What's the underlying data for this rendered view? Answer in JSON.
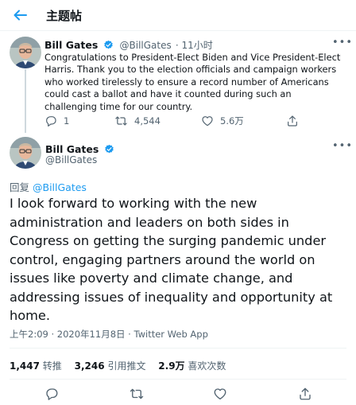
{
  "header": {
    "title": "主题帖"
  },
  "parent_tweet": {
    "author_name": "Bill Gates",
    "author_handle": "@BillGates",
    "time": "· 11小时",
    "text": "Congratulations to President-Elect Biden and Vice President-Elect Harris. Thank you to the election officials and campaign workers who worked tirelessly to ensure a record number of Americans could cast a ballot and have it counted during such an challenging time for our country.",
    "reply_count": "1",
    "retweet_count": "4,544",
    "like_count": "5.6万"
  },
  "main_tweet": {
    "author_name": "Bill Gates",
    "author_handle": "@BillGates",
    "reply_label": "回复",
    "reply_to": "@BillGates",
    "text": "I look forward to working with the new administration and leaders on both sides in Congress on getting the surging pandemic under control, engaging partners around the world on issues like poverty and climate change, and addressing issues of inequality and opportunity at home.",
    "meta": "上午2:09 · 2020年11月8日 · Twitter Web App",
    "stats": {
      "retweets": "1,447",
      "retweets_label": "转推",
      "quotes": "3,246",
      "quotes_label": "引用推文",
      "likes": "2.9万",
      "likes_label": "喜欢次数"
    }
  },
  "colors": {
    "accent": "#1d9bf0",
    "secondary_text": "#536471",
    "border": "#eff3f4"
  },
  "icons": [
    "back-arrow-icon",
    "verified-badge-icon",
    "more-icon",
    "reply-icon",
    "retweet-icon",
    "like-icon",
    "share-icon"
  ]
}
